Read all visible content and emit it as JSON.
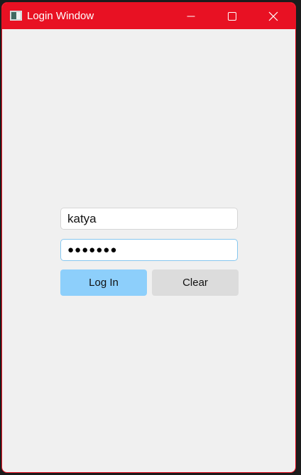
{
  "window": {
    "title": "Login Window",
    "accent_color": "#e81123",
    "app_icon": "window-app-icon",
    "controls": {
      "minimize_icon": "minimize-icon",
      "maximize_icon": "maximize-icon",
      "close_icon": "close-icon"
    }
  },
  "form": {
    "username_value": "katya",
    "password_masked": "●●●●●●●",
    "login_label": "Log In",
    "clear_label": "Clear",
    "login_color": "#8dcffb",
    "clear_color": "#dcdcdc"
  }
}
